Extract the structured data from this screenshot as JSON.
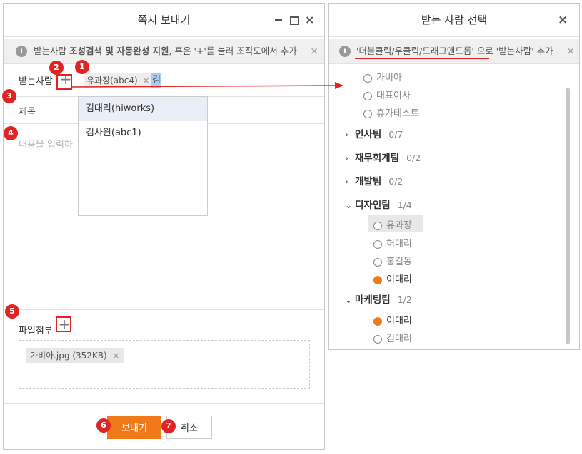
{
  "left_window": {
    "title": "쪽지 보내기",
    "controls": [
      "minimize",
      "maximize",
      "close"
    ],
    "info_text_1": "받는사람 ",
    "info_text_bold": "조성검색 및 자동완성 지원",
    "info_text_2": ", 혹은 '+'를 눌러 조직도에서 추가",
    "to_label": "받는사람",
    "recipient_chip": "유과장(abc4)",
    "chip_remove": "×",
    "search_value": "김",
    "suggestions": [
      "김대리(hiworks)",
      "김사원(abc1)"
    ],
    "subject_label": "제목",
    "content_placeholder": "내용을 입력하",
    "attach_label": "파일첨부",
    "attachment": "가비아.jpg (352KB)",
    "attachment_remove": "×",
    "send_button": "보내기",
    "cancel_button": "취소"
  },
  "right_window": {
    "title": "받는 사람 선택",
    "close": "×",
    "info_text": "'더블클릭/우클릭/드래그앤드롭' 으로 '받는사람' 추가",
    "info_close": "×",
    "top_members": [
      "가비아",
      "대표이사",
      "휴가테스트"
    ],
    "teams": [
      {
        "name": "인사팀",
        "count": "0/7",
        "expanded": false
      },
      {
        "name": "재무회계팀",
        "count": "0/2",
        "expanded": false
      },
      {
        "name": "개발팀",
        "count": "0/2",
        "expanded": false
      },
      {
        "name": "디자인팀",
        "count": "1/4",
        "expanded": true,
        "members": [
          "유과장",
          "허대리",
          "홍길동",
          "이대리"
        ]
      },
      {
        "name": "마케팅팀",
        "count": "1/2",
        "expanded": true,
        "members": [
          "이대리",
          "김대리"
        ]
      }
    ]
  },
  "badges": [
    "1",
    "2",
    "3",
    "4",
    "5",
    "6",
    "7"
  ],
  "colors": {
    "accent": "#f07a1a",
    "highlight_red": "#e02323",
    "chip_bg": "#e8e8e8"
  }
}
